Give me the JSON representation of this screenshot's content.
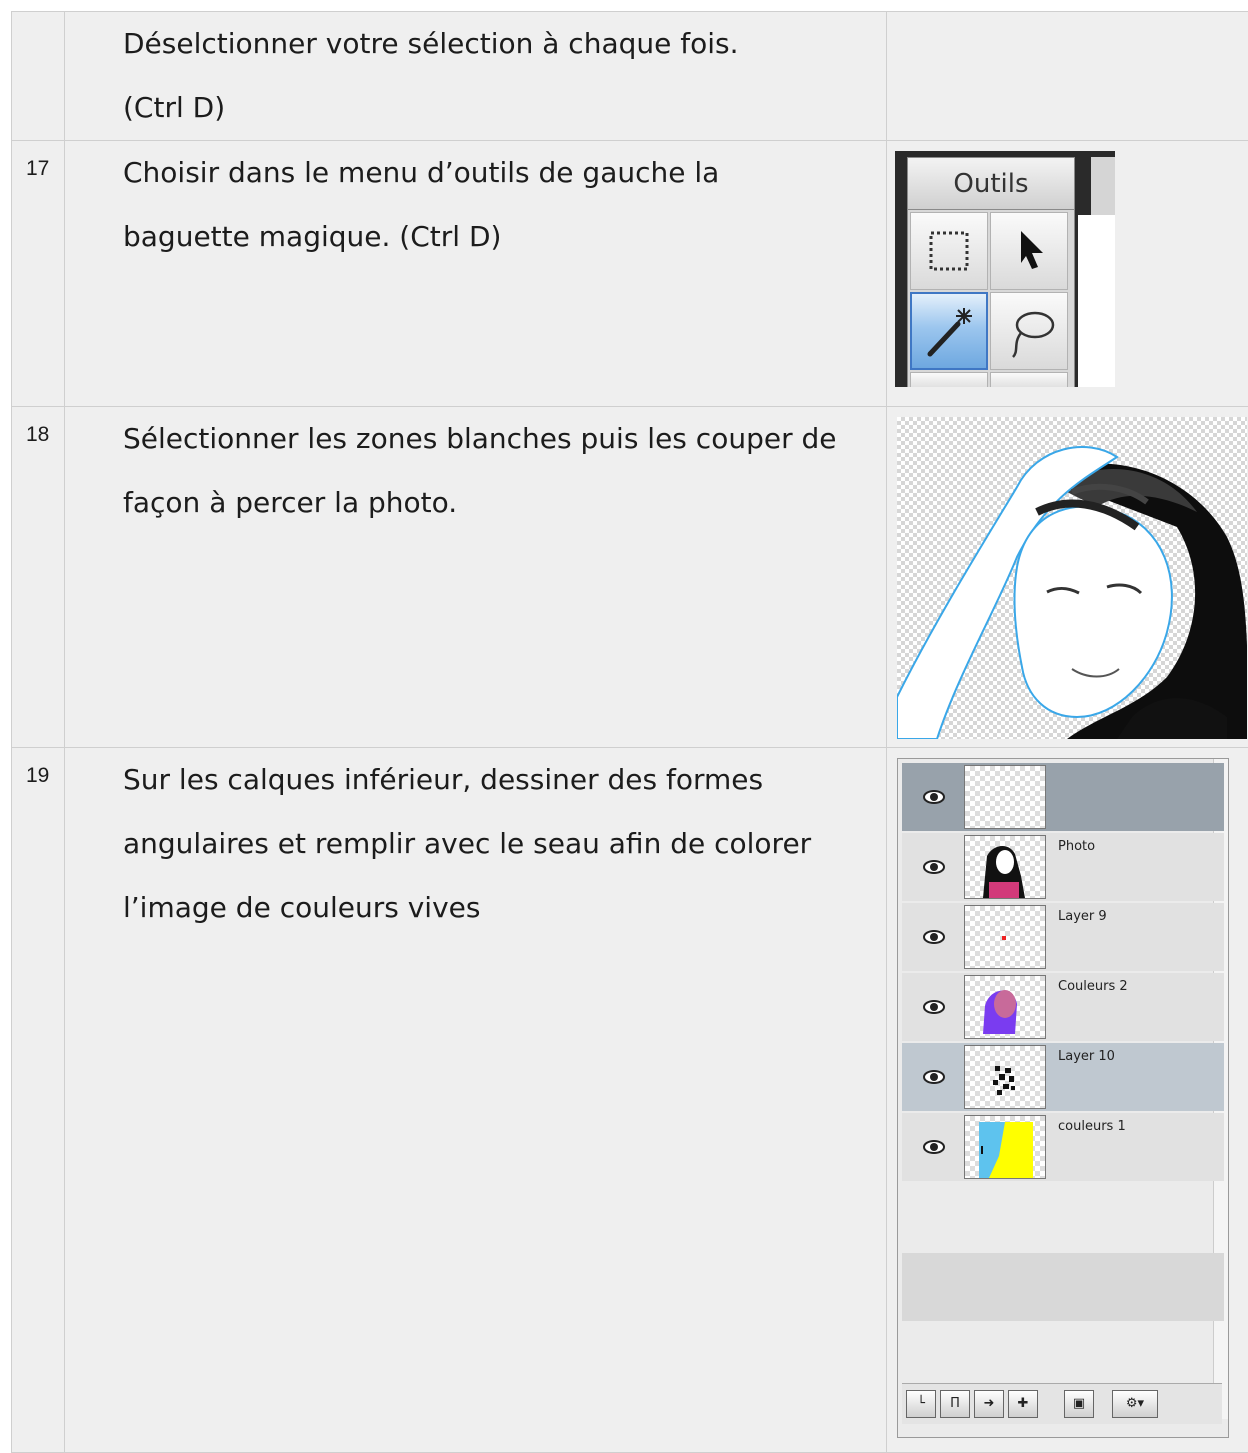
{
  "steps": [
    {
      "number": "",
      "lines": [
        "Déselctionner votre sélection à chaque fois.",
        "(Ctrl D)"
      ]
    },
    {
      "number": "17",
      "lines": [
        "Choisir dans le menu d’outils de gauche la",
        "baguette magique. (Ctrl D)"
      ]
    },
    {
      "number": "18",
      "lines": [
        "Sélectionner les zones blanches puis les couper de",
        "façon à percer la photo."
      ]
    },
    {
      "number": "19",
      "lines": [
        "Sur les calques inférieur, dessiner des formes",
        "angulaires et remplir avec le seau afin de colorer",
        "l’image de couleurs vives"
      ]
    }
  ],
  "tools_panel": {
    "tab_label": "Outils",
    "tools": [
      "marquee-icon",
      "pointer-icon",
      "magic-wand-icon",
      "lasso-icon"
    ],
    "selected_tool": "magic-wand-icon"
  },
  "layers_panel": {
    "layers": [
      {
        "name": "",
        "icon": "eye-icon"
      },
      {
        "name": "Photo",
        "icon": "eye-icon"
      },
      {
        "name": "Layer 9",
        "icon": "eye-icon"
      },
      {
        "name": "Couleurs 2",
        "icon": "eye-icon"
      },
      {
        "name": "Layer 10",
        "icon": "eye-icon"
      },
      {
        "name": "couleurs 1",
        "icon": "eye-icon"
      }
    ],
    "buttons": [
      "new-layer-icon",
      "duplicate-icon",
      "move-icon",
      "merge-icon",
      "image-icon",
      "settings-icon"
    ]
  }
}
